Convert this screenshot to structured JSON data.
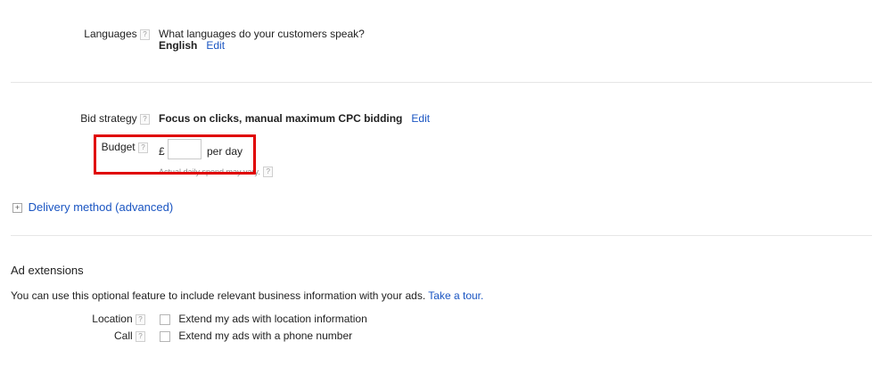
{
  "languages": {
    "label": "Languages",
    "help": "?",
    "question": "What languages do your customers speak?",
    "value": "English",
    "edit": "Edit"
  },
  "bid_strategy": {
    "label": "Bid strategy",
    "help": "?",
    "value": "Focus on clicks, manual maximum CPC bidding",
    "edit": "Edit"
  },
  "budget": {
    "label": "Budget",
    "help": "?",
    "currency": "£",
    "input_value": "",
    "suffix": "per day",
    "note": "Actual daily spend may vary.",
    "note_help": "?"
  },
  "delivery": {
    "expand_symbol": "+",
    "label": "Delivery method (advanced)"
  },
  "ad_extensions": {
    "heading": "Ad extensions",
    "description": "You can use this optional feature to include relevant business information with your ads.",
    "tour_link": "Take a tour.",
    "items": [
      {
        "label": "Location",
        "help": "?",
        "checkbox_label": "Extend my ads with location information",
        "checked": false
      },
      {
        "label": "Call",
        "help": "?",
        "checkbox_label": "Extend my ads with a phone number",
        "checked": false
      }
    ]
  },
  "colors": {
    "link": "#1a55c2",
    "highlight_border": "#e00000",
    "divider": "#e6e6e6"
  }
}
